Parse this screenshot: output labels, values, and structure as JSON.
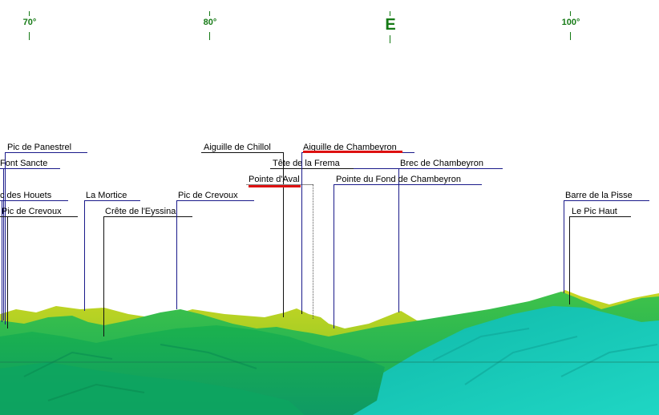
{
  "compass": {
    "ticks": [
      {
        "label": "70°",
        "cardinal": false
      },
      {
        "label": "80°",
        "cardinal": false
      },
      {
        "label": "E",
        "cardinal": true
      },
      {
        "label": "100°",
        "cardinal": false
      }
    ]
  },
  "peaks": [
    {
      "name": "Pic de Panestrel",
      "line_color": "#1a1a8a"
    },
    {
      "name": "Font Sancte",
      "line_color": "#1a1a8a"
    },
    {
      "name": "c des Houets",
      "line_color": "#1a1a8a"
    },
    {
      "name": "Pic de Crevoux",
      "line_color": "#111111"
    },
    {
      "name": "La Mortice",
      "line_color": "#1a1a8a"
    },
    {
      "name": "Crête de l'Eyssina",
      "line_color": "#111111"
    },
    {
      "name": "Pic de Crevoux",
      "line_color": "#1a1a8a"
    },
    {
      "name": "Aiguille de Chillol",
      "line_color": "#111111"
    },
    {
      "name": "Tête de la Frema",
      "line_color": "#111111"
    },
    {
      "name": "Pointe d'Aval",
      "line_color": "#888888",
      "highlighted": true
    },
    {
      "name": "Aiguille de Chambeyron",
      "line_color": "#1a1a8a",
      "highlighted": true
    },
    {
      "name": "Brec de Chambeyron",
      "line_color": "#1a1a8a"
    },
    {
      "name": "Pointe du Fond de Chambeyron",
      "line_color": "#1a1a8a"
    },
    {
      "name": "Barre de la Pisse",
      "line_color": "#1a1a8a"
    },
    {
      "name": "Le Pic Haut",
      "line_color": "#111111"
    }
  ],
  "colors": {
    "highlight": "#dd1111",
    "compass": "#157a15",
    "sky": "#ffffff",
    "terrain_near": "#12c8b8",
    "terrain_mid": "#18b86a",
    "terrain_far": "#8ad02a"
  }
}
